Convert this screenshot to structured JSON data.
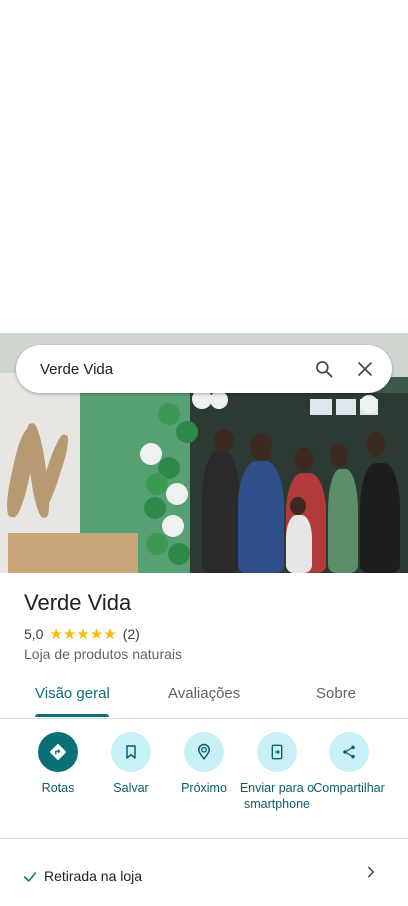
{
  "search": {
    "query": "Verde Vida"
  },
  "place": {
    "name": "Verde Vida",
    "rating": "5,0",
    "stars": "★★★★★",
    "review_count": "(2)",
    "category": "Loja de produtos naturais"
  },
  "tabs": [
    {
      "label": "Visão geral",
      "active": true
    },
    {
      "label": "Avaliações",
      "active": false
    },
    {
      "label": "Sobre",
      "active": false
    }
  ],
  "actions": [
    {
      "label": "Rotas",
      "icon": "directions-icon"
    },
    {
      "label": "Salvar",
      "icon": "bookmark-icon"
    },
    {
      "label": "Próximo",
      "icon": "nearby-icon"
    },
    {
      "label": "Enviar para o smartphone",
      "icon": "send-to-phone-icon"
    },
    {
      "label": "Compartilhar",
      "icon": "share-icon"
    }
  ],
  "pickup": {
    "label": "Retirada na loja"
  },
  "colors": {
    "accent": "#0b6f78",
    "action_bg": "#c8f0f7",
    "star": "#fbbc04"
  }
}
